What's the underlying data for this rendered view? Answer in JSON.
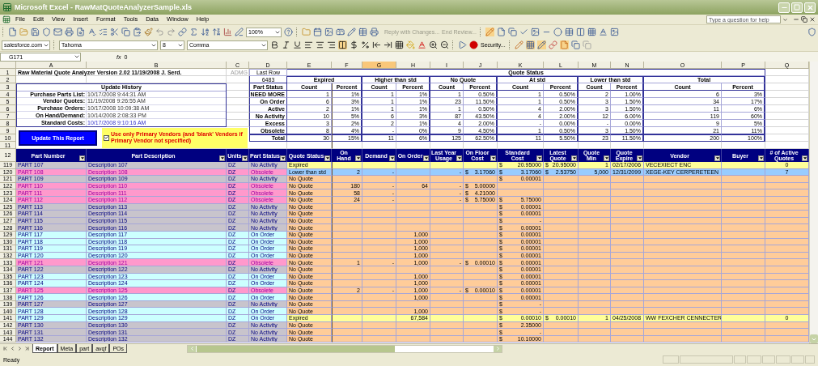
{
  "window": {
    "title": "Microsoft Excel - RawMatQuoteAnalyzerSample.xls"
  },
  "menu": [
    "File",
    "Edit",
    "View",
    "Insert",
    "Format",
    "Tools",
    "Data",
    "Window",
    "Help"
  ],
  "help_search": {
    "placeholder": "Type a question for help"
  },
  "toolbar": {
    "zoom": "100%",
    "reply": "Reply with Changes...",
    "end_review": "End Review...",
    "review_disabled": true,
    "addin": "salesforce.com",
    "font": "Tahoma",
    "font_size": "8",
    "style": "Comma",
    "security": "Security..."
  },
  "formula_bar": {
    "name_box": "G171",
    "function_label": "fx",
    "value": "0"
  },
  "column_headers": [
    {
      "label": "A",
      "selected": false
    },
    {
      "label": "B",
      "selected": false
    },
    {
      "label": "C",
      "selected": false
    },
    {
      "label": "D",
      "selected": false
    },
    {
      "label": "E",
      "selected": false
    },
    {
      "label": "F",
      "selected": false
    },
    {
      "label": "G",
      "selected": true
    },
    {
      "label": "H",
      "selected": false
    },
    {
      "label": "I",
      "selected": false
    },
    {
      "label": "J",
      "selected": false
    },
    {
      "label": "K",
      "selected": false
    },
    {
      "label": "L",
      "selected": false
    },
    {
      "label": "M",
      "selected": false
    },
    {
      "label": "N",
      "selected": false
    },
    {
      "label": "O",
      "selected": false
    },
    {
      "label": "P",
      "selected": false
    },
    {
      "label": "Q",
      "selected": false
    }
  ],
  "row_numbers": [
    "1",
    "2",
    "3",
    "4",
    "5",
    "6",
    "7",
    "8",
    "9",
    "10",
    "11"
  ],
  "report": {
    "title": "Raw Material Quote Analyzer Version 2.02 11/19/2008 J. Serd.",
    "note": "ADMG",
    "history_title": "Update History",
    "history": [
      {
        "label": "Purchase Parts List:",
        "value": "10/17/2008 9:44:31 AM",
        "highlighted": false
      },
      {
        "label": "Vendor Quotes:",
        "value": "11/19/2008 9:26:55 AM",
        "highlighted": false
      },
      {
        "label": "Purchase Orders:",
        "value": "10/17/2008 10:09:38 AM",
        "highlighted": false
      },
      {
        "label": "On Hand/Demand:",
        "value": "10/14/2008 2:08:33 PM",
        "highlighted": false
      },
      {
        "label": "Standard Costs:",
        "value": "10/17/2008 9:10:16 AM",
        "highlighted": true
      }
    ],
    "update_button": "Update This Report",
    "primary_vendors": {
      "checked": true,
      "label": "Use only Primary Vendors (and 'blank' Vendors if Primary Vendor not specified)"
    }
  },
  "quote_status": {
    "last_row_label": "Last Row",
    "last_row": "6483",
    "title": "Quote Status",
    "part_status_label": "Part Status",
    "groups": [
      "Expired",
      "Higher than std",
      "No Quote",
      "At std",
      "Lower than std",
      "Total"
    ],
    "columns": [
      "Count",
      "Percent",
      "Count",
      "Percent",
      "Count",
      "Percent",
      "Count",
      "Percent",
      "Count",
      "Percent",
      "Count",
      "Percent"
    ],
    "rows": [
      {
        "status": "NEED MORE",
        "values": [
          "1",
          "1%",
          "1",
          "1%",
          "1",
          "0.50%",
          "1",
          "0.50%",
          "2",
          "1.00%",
          "6",
          "3%"
        ]
      },
      {
        "status": "On Order",
        "values": [
          "6",
          "3%",
          "1",
          "1%",
          "23",
          "11.50%",
          "1",
          "0.50%",
          "3",
          "1.50%",
          "34",
          "17%"
        ]
      },
      {
        "status": "Active",
        "values": [
          "2",
          "1%",
          "1",
          "1%",
          "1",
          "0.50%",
          "4",
          "2.00%",
          "3",
          "1.50%",
          "11",
          "6%"
        ]
      },
      {
        "status": "No Activity",
        "values": [
          "10",
          "5%",
          "6",
          "3%",
          "87",
          "43.50%",
          "4",
          "2.00%",
          "12",
          "6.00%",
          "119",
          "60%"
        ]
      },
      {
        "status": "Excess",
        "values": [
          "3",
          "2%",
          "2",
          "1%",
          "4",
          "2.00%",
          "-",
          "0.00%",
          "-",
          "0.00%",
          "9",
          "5%"
        ]
      },
      {
        "status": "Obsolete",
        "values": [
          "8",
          "4%",
          "-",
          "0%",
          "9",
          "4.50%",
          "1",
          "0.50%",
          "3",
          "1.50%",
          "21",
          "11%"
        ]
      }
    ],
    "total": {
      "status": "Total",
      "values": [
        "30",
        "15%",
        "11",
        "6%",
        "125",
        "62.50%",
        "11",
        "5.50%",
        "23",
        "11.50%",
        "200",
        "100%"
      ]
    }
  },
  "table": {
    "header_row_number": "12",
    "columns": [
      "Part Number",
      "Part Description",
      "Units",
      "Part Status",
      "Quote Status",
      "On Hand",
      "Demand",
      "On Order",
      "Last Year Usage",
      "On Floor Cost",
      "Standard Cost",
      "Latest Quote",
      "Quote Min",
      "Quote Expire",
      "Vendor",
      "Buyer",
      "# of Active Quotes"
    ],
    "rows": [
      {
        "row_number": "119",
        "kind": "no_activity",
        "quote": {
          "kind": "expired"
        },
        "cells": [
          "PART 107",
          "Description 107",
          "DZ",
          "No Activity",
          "Expired",
          null,
          null,
          null,
          null,
          null,
          [
            "$",
            "20.95000"
          ],
          [
            "$",
            "20.95000"
          ],
          "1",
          "02/17/2006",
          "VECEXIECT ENC",
          null,
          "0"
        ]
      },
      {
        "row_number": "120",
        "kind": "obsolete",
        "quote": {
          "kind": "lower"
        },
        "cells": [
          "PART 108",
          "Description 108",
          "DZ",
          "Obsolete",
          "Lower than std",
          "2",
          "-",
          null,
          "-",
          [
            "$",
            "3.17060"
          ],
          [
            "$",
            "3.17060"
          ],
          [
            "$",
            "2.53750"
          ],
          "5,000",
          "12/31/2099",
          "XEGE-KEY CERPERETEEN",
          null,
          "7"
        ]
      },
      {
        "row_number": "121",
        "kind": "no_activity",
        "quote": {
          "kind": "none"
        },
        "cells": [
          "PART 109",
          "Description 109",
          "DZ",
          "No Activity",
          "No Quote",
          null,
          null,
          null,
          null,
          null,
          [
            "$",
            "0.00001"
          ],
          null,
          null,
          null,
          null,
          null,
          null
        ]
      },
      {
        "row_number": "122",
        "kind": "obsolete",
        "quote": {
          "kind": "none"
        },
        "cells": [
          "PART 110",
          "Description 110",
          "DZ",
          "Obsolete",
          "No Quote",
          "180",
          "-",
          "64",
          "-",
          [
            "$",
            "5.00000"
          ],
          null,
          null,
          null,
          null,
          null,
          null,
          null
        ]
      },
      {
        "row_number": "123",
        "kind": "obsolete",
        "quote": {
          "kind": "none"
        },
        "cells": [
          "PART 111",
          "Description 111",
          "DZ",
          "Obsolete",
          "No Quote",
          "58",
          "-",
          null,
          "-",
          [
            "$",
            "4.21000"
          ],
          null,
          null,
          null,
          null,
          null,
          null,
          null
        ]
      },
      {
        "row_number": "124",
        "kind": "obsolete",
        "quote": {
          "kind": "none"
        },
        "cells": [
          "PART 112",
          "Description 112",
          "DZ",
          "Obsolete",
          "No Quote",
          "24",
          "-",
          null,
          "-",
          [
            "$",
            "5.75000"
          ],
          [
            "$",
            "5.75000"
          ],
          null,
          null,
          null,
          null,
          null,
          null
        ]
      },
      {
        "row_number": "125",
        "kind": "no_activity",
        "quote": {
          "kind": "none"
        },
        "cells": [
          "PART 113",
          "Description 113",
          "DZ",
          "No Activity",
          "No Quote",
          null,
          null,
          null,
          null,
          null,
          [
            "$",
            "0.00001"
          ],
          null,
          null,
          null,
          null,
          null,
          null
        ]
      },
      {
        "row_number": "126",
        "kind": "no_activity",
        "quote": {
          "kind": "none"
        },
        "cells": [
          "PART 114",
          "Description 114",
          "DZ",
          "No Activity",
          "No Quote",
          null,
          null,
          null,
          null,
          null,
          [
            "$",
            "0.00001"
          ],
          null,
          null,
          null,
          null,
          null,
          null
        ]
      },
      {
        "row_number": "127",
        "kind": "no_activity",
        "quote": {
          "kind": "none"
        },
        "cells": [
          "PART 115",
          "Description 115",
          "DZ",
          "No Activity",
          "No Quote",
          null,
          null,
          null,
          null,
          null,
          [
            "$",
            "-"
          ],
          null,
          null,
          null,
          null,
          null,
          null
        ]
      },
      {
        "row_number": "128",
        "kind": "no_activity",
        "quote": {
          "kind": "none"
        },
        "cells": [
          "PART 116",
          "Description 116",
          "DZ",
          "No Activity",
          "No Quote",
          null,
          null,
          null,
          null,
          null,
          [
            "$",
            "0.00001"
          ],
          null,
          null,
          null,
          null,
          null,
          null
        ]
      },
      {
        "row_number": "129",
        "kind": "on_order",
        "quote": {
          "kind": "none"
        },
        "cells": [
          "PART 117",
          "Description 117",
          "DZ",
          "On Order",
          "No Quote",
          null,
          null,
          "1,000",
          null,
          null,
          [
            "$",
            "0.00001"
          ],
          null,
          null,
          null,
          null,
          null,
          null
        ]
      },
      {
        "row_number": "130",
        "kind": "on_order",
        "quote": {
          "kind": "none"
        },
        "cells": [
          "PART 118",
          "Description 118",
          "DZ",
          "On Order",
          "No Quote",
          null,
          null,
          "1,000",
          null,
          null,
          [
            "$",
            "0.00001"
          ],
          null,
          null,
          null,
          null,
          null,
          null
        ]
      },
      {
        "row_number": "131",
        "kind": "on_order",
        "quote": {
          "kind": "none"
        },
        "cells": [
          "PART 119",
          "Description 119",
          "DZ",
          "On Order",
          "No Quote",
          null,
          null,
          "1,000",
          null,
          null,
          [
            "$",
            "0.00001"
          ],
          null,
          null,
          null,
          null,
          null,
          null
        ]
      },
      {
        "row_number": "132",
        "kind": "on_order",
        "quote": {
          "kind": "none"
        },
        "cells": [
          "PART 120",
          "Description 120",
          "DZ",
          "On Order",
          "No Quote",
          null,
          null,
          "1,000",
          null,
          null,
          [
            "$",
            "0.00001"
          ],
          null,
          null,
          null,
          null,
          null,
          null
        ]
      },
      {
        "row_number": "133",
        "kind": "obsolete",
        "quote": {
          "kind": "none"
        },
        "cells": [
          "PART 121",
          "Description 121",
          "DZ",
          "Obsolete",
          "No Quote",
          "1",
          "-",
          "1,000",
          "-",
          [
            "$",
            "0.00010"
          ],
          [
            "$",
            "0.00001"
          ],
          null,
          null,
          null,
          null,
          null,
          null
        ]
      },
      {
        "row_number": "134",
        "kind": "no_activity",
        "quote": {
          "kind": "none"
        },
        "cells": [
          "PART 122",
          "Description 122",
          "DZ",
          "No Activity",
          "No Quote",
          null,
          null,
          null,
          null,
          null,
          [
            "$",
            "0.00001"
          ],
          null,
          null,
          null,
          null,
          null,
          null
        ]
      },
      {
        "row_number": "135",
        "kind": "on_order",
        "quote": {
          "kind": "none"
        },
        "cells": [
          "PART 123",
          "Description 123",
          "DZ",
          "On Order",
          "No Quote",
          null,
          null,
          "1,000",
          null,
          null,
          [
            "$",
            "0.00001"
          ],
          null,
          null,
          null,
          null,
          null,
          null
        ]
      },
      {
        "row_number": "136",
        "kind": "on_order",
        "quote": {
          "kind": "none"
        },
        "cells": [
          "PART 124",
          "Description 124",
          "DZ",
          "On Order",
          "No Quote",
          null,
          null,
          "1,000",
          null,
          null,
          [
            "$",
            "0.00001"
          ],
          null,
          null,
          null,
          null,
          null,
          null
        ]
      },
      {
        "row_number": "137",
        "kind": "obsolete",
        "quote": {
          "kind": "none"
        },
        "cells": [
          "PART 125",
          "Description 125",
          "DZ",
          "Obsolete",
          "No Quote",
          "2",
          "-",
          "1,000",
          "-",
          [
            "$",
            "0.00010"
          ],
          [
            "$",
            "0.00001"
          ],
          null,
          null,
          null,
          null,
          null,
          null
        ]
      },
      {
        "row_number": "138",
        "kind": "on_order",
        "quote": {
          "kind": "none"
        },
        "cells": [
          "PART 126",
          "Description 126",
          "DZ",
          "On Order",
          "No Quote",
          null,
          null,
          "1,000",
          null,
          null,
          [
            "$",
            "0.00001"
          ],
          null,
          null,
          null,
          null,
          null,
          null
        ]
      },
      {
        "row_number": "139",
        "kind": "no_activity",
        "quote": {
          "kind": "none"
        },
        "cells": [
          "PART 127",
          "Description 127",
          "DZ",
          "No Activity",
          "No Quote",
          null,
          null,
          null,
          null,
          null,
          [
            "$",
            "-"
          ],
          null,
          null,
          null,
          null,
          null,
          null
        ]
      },
      {
        "row_number": "140",
        "kind": "on_order",
        "quote": {
          "kind": "none"
        },
        "cells": [
          "PART 128",
          "Description 128",
          "DZ",
          "On Order",
          "No Quote",
          null,
          null,
          "1,000",
          null,
          null,
          [
            "$",
            "-"
          ],
          null,
          null,
          null,
          null,
          null,
          null
        ]
      },
      {
        "row_number": "141",
        "kind": "on_order",
        "quote": {
          "kind": "expired"
        },
        "cells": [
          "PART 129",
          "Description 129",
          "DZ",
          "On Order",
          "Expired",
          null,
          null,
          "67,584",
          null,
          null,
          [
            "$",
            "0.00010"
          ],
          [
            "$",
            "0.00010"
          ],
          "1",
          "04/25/2008",
          "WW FEXCHER CENNECTER",
          null,
          "0"
        ]
      },
      {
        "row_number": "142",
        "kind": "no_activity",
        "quote": {
          "kind": "none"
        },
        "cells": [
          "PART 130",
          "Description 130",
          "DZ",
          "No Activity",
          "No Quote",
          null,
          null,
          null,
          null,
          null,
          [
            "$",
            "2.35000"
          ],
          null,
          null,
          null,
          null,
          null,
          null
        ]
      },
      {
        "row_number": "143",
        "kind": "no_activity",
        "quote": {
          "kind": "none"
        },
        "cells": [
          "PART 131",
          "Description 131",
          "DZ",
          "No Activity",
          "No Quote",
          null,
          null,
          null,
          null,
          null,
          [
            "$",
            "-"
          ],
          null,
          null,
          null,
          null,
          null,
          null
        ]
      },
      {
        "row_number": "144",
        "kind": "no_activity",
        "quote": {
          "kind": "none"
        },
        "cells": [
          "PART 132",
          "Description 132",
          "DZ",
          "No Activity",
          "No Quote",
          null,
          null,
          null,
          null,
          null,
          [
            "$",
            "10.10000"
          ],
          null,
          null,
          null,
          null,
          null,
          null
        ]
      }
    ]
  },
  "sheet_tabs": [
    {
      "label": "Report",
      "selected": true
    },
    {
      "label": "Meta",
      "selected": false
    },
    {
      "label": "part",
      "selected": false
    },
    {
      "label": "avqf",
      "selected": false
    },
    {
      "label": "POs",
      "selected": false
    }
  ],
  "status_bar": {
    "text": "Ready"
  }
}
